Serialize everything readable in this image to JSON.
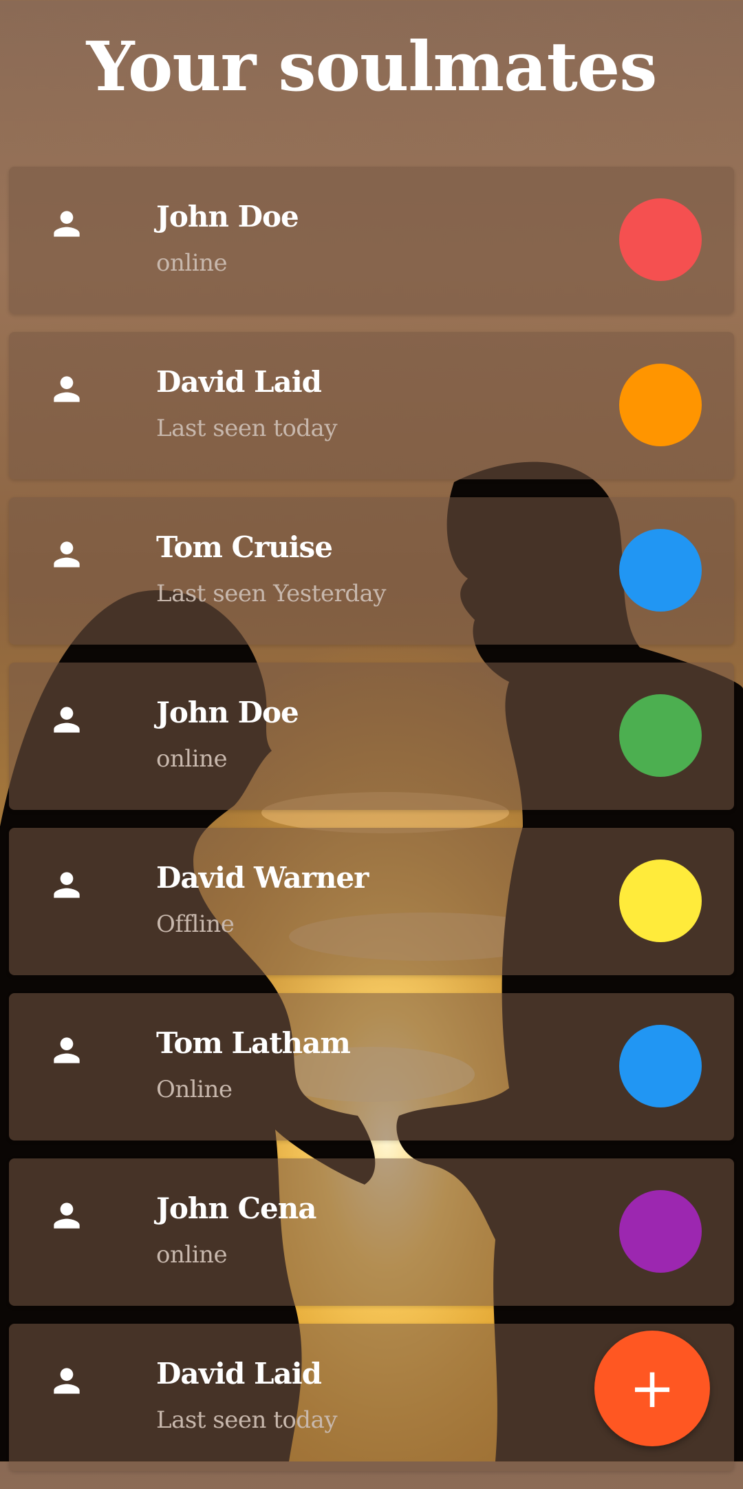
{
  "header": {
    "title": "Your soulmates"
  },
  "contacts": [
    {
      "name": "John Doe",
      "status": "online",
      "color": "#F55050"
    },
    {
      "name": "David Laid",
      "status": "Last seen today",
      "color": "#FF9500"
    },
    {
      "name": "Tom Cruise",
      "status": "Last seen Yesterday",
      "color": "#2196F3"
    },
    {
      "name": "John Doe",
      "status": "online",
      "color": "#4CAF50"
    },
    {
      "name": "David Warner",
      "status": "Offline",
      "color": "#FFEB3B"
    },
    {
      "name": "Tom Latham",
      "status": "Online",
      "color": "#2196F3"
    },
    {
      "name": "John Cena",
      "status": "online",
      "color": "#9C27B0"
    },
    {
      "name": "David Laid",
      "status": "Last seen today",
      "color": "#FF5722"
    }
  ],
  "fab": {
    "label": "+",
    "color": "#FF5722",
    "icon": "plus-icon"
  },
  "icons": {
    "contact": "person-icon"
  }
}
